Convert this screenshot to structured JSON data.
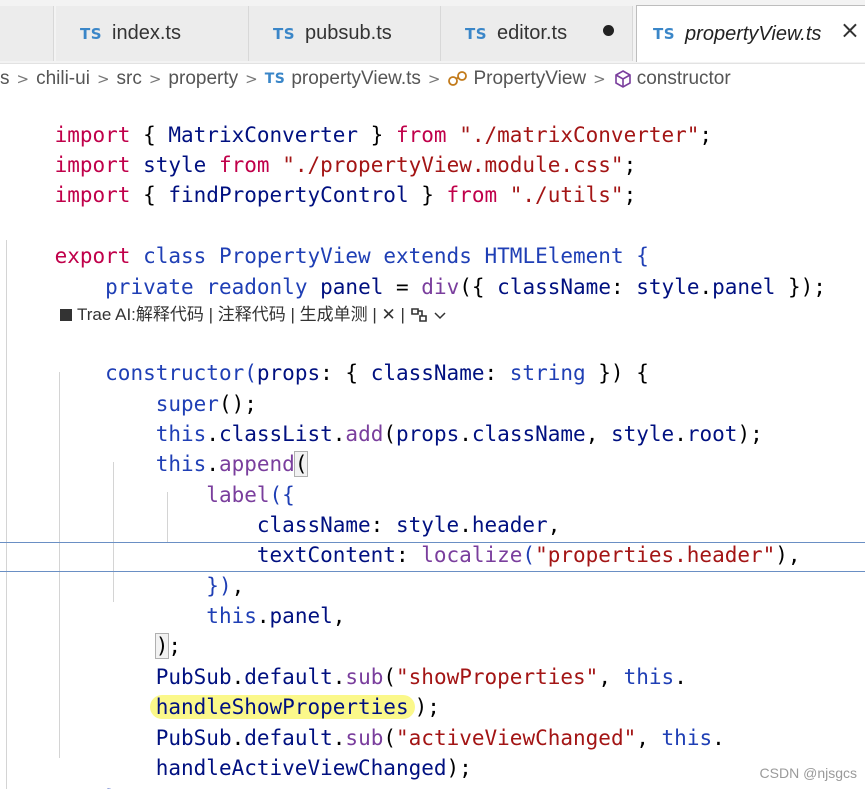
{
  "tabs": [
    {
      "badge": "TS",
      "label": "index.ts"
    },
    {
      "badge": "TS",
      "label": "pubsub.ts"
    },
    {
      "badge": "TS",
      "label": "editor.ts",
      "dirty": true
    },
    {
      "badge": "TS",
      "label": "propertyView.ts",
      "active": true,
      "close": "×"
    }
  ],
  "breadcrumb": {
    "items": [
      "s",
      "chili-ui",
      "src",
      "property",
      "propertyView.ts",
      "PropertyView",
      "constructor"
    ],
    "sep": ">",
    "file_badge": "TS"
  },
  "code_lens": {
    "text": "Trae AI:解释代码 | 注释代码 | 生成单测 | ✕ |"
  },
  "code": {
    "l1": {
      "a": "import",
      "b": " { ",
      "c": "MatrixConverter",
      "d": " } ",
      "e": "from",
      "f": " ",
      "g": "\"./matrixConverter\"",
      "h": ";"
    },
    "l2": {
      "a": "import",
      "b": " ",
      "c": "style",
      "d": " ",
      "e": "from",
      "f": " ",
      "g": "\"./propertyView.module.css\"",
      "h": ";"
    },
    "l3": {
      "a": "import",
      "b": " { ",
      "c": "findPropertyControl",
      "d": " } ",
      "e": "from",
      "f": " ",
      "g": "\"./utils\"",
      "h": ";"
    },
    "l5": {
      "a": "export",
      "b": " ",
      "c": "class",
      "d": " ",
      "e": "PropertyView",
      "f": " ",
      "g": "extends",
      "h": " ",
      "i": "HTMLElement",
      "j": " {"
    },
    "l6": {
      "a": "    ",
      "b": "private",
      "c": " ",
      "d": "readonly",
      "e": " ",
      "f": "panel",
      "g": " = ",
      "h": "div",
      "i": "({ ",
      "j": "className",
      "k": ": ",
      "l": "style",
      "m": ".",
      "n": "panel",
      "o": " });"
    },
    "l8": {
      "a": "    ",
      "b": "constructor",
      "c": "(",
      "d": "props",
      "e": ": { ",
      "f": "className",
      "g": ": ",
      "h": "string",
      "i": " }) {"
    },
    "l9": {
      "a": "        ",
      "b": "super",
      "c": "();"
    },
    "l10": {
      "a": "        ",
      "b": "this",
      "c": ".",
      "d": "classList",
      "e": ".",
      "f": "add",
      "g": "(",
      "h": "props",
      "i": ".",
      "j": "className",
      "k": ", ",
      "l": "style",
      "m": ".",
      "n": "root",
      "o": ");"
    },
    "l11": {
      "a": "        ",
      "b": "this",
      "c": ".",
      "d": "append",
      "e": "("
    },
    "l12": {
      "a": "            ",
      "b": "label",
      "c": "({"
    },
    "l13": {
      "a": "                ",
      "b": "className",
      "c": ": ",
      "d": "style",
      "e": ".",
      "f": "header",
      "g": ","
    },
    "l14": {
      "a": "                ",
      "b": "textContent",
      "c": ": ",
      "d": "localize",
      "e": "(",
      "f": "\"properties.header\"",
      "g": "),"
    },
    "l15": {
      "a": "            ",
      "b": "})",
      "c": ","
    },
    "l16": {
      "a": "            ",
      "b": "this",
      "c": ".",
      "d": "panel",
      "e": ","
    },
    "l17": {
      "a": "        ",
      "b": ")",
      "c": ";"
    },
    "l18": {
      "a": "        ",
      "b": "PubSub",
      "c": ".",
      "d": "default",
      "e": ".",
      "f": "sub",
      "g": "(",
      "h": "\"showProperties\"",
      "i": ", ",
      "j": "this",
      "k": "."
    },
    "l19": {
      "a": "        ",
      "b": "handleShowProperties",
      "c": ");"
    },
    "l20": {
      "a": "        ",
      "b": "PubSub",
      "c": ".",
      "d": "default",
      "e": ".",
      "f": "sub",
      "g": "(",
      "h": "\"activeViewChanged\"",
      "i": ", ",
      "j": "this",
      "k": "."
    },
    "l21": {
      "a": "        ",
      "b": "handleActiveViewChanged",
      "c": ");"
    },
    "l22": {
      "a": "    ",
      "b": "}"
    }
  },
  "watermark": "CSDN @njsgcs",
  "colors": {
    "keyword": "#c0004a",
    "keyword_blue": "#1f3fb5",
    "string": "#a31515",
    "identifier": "#001080",
    "function": "#7a3e9d",
    "highlight": "#fbf88a"
  }
}
